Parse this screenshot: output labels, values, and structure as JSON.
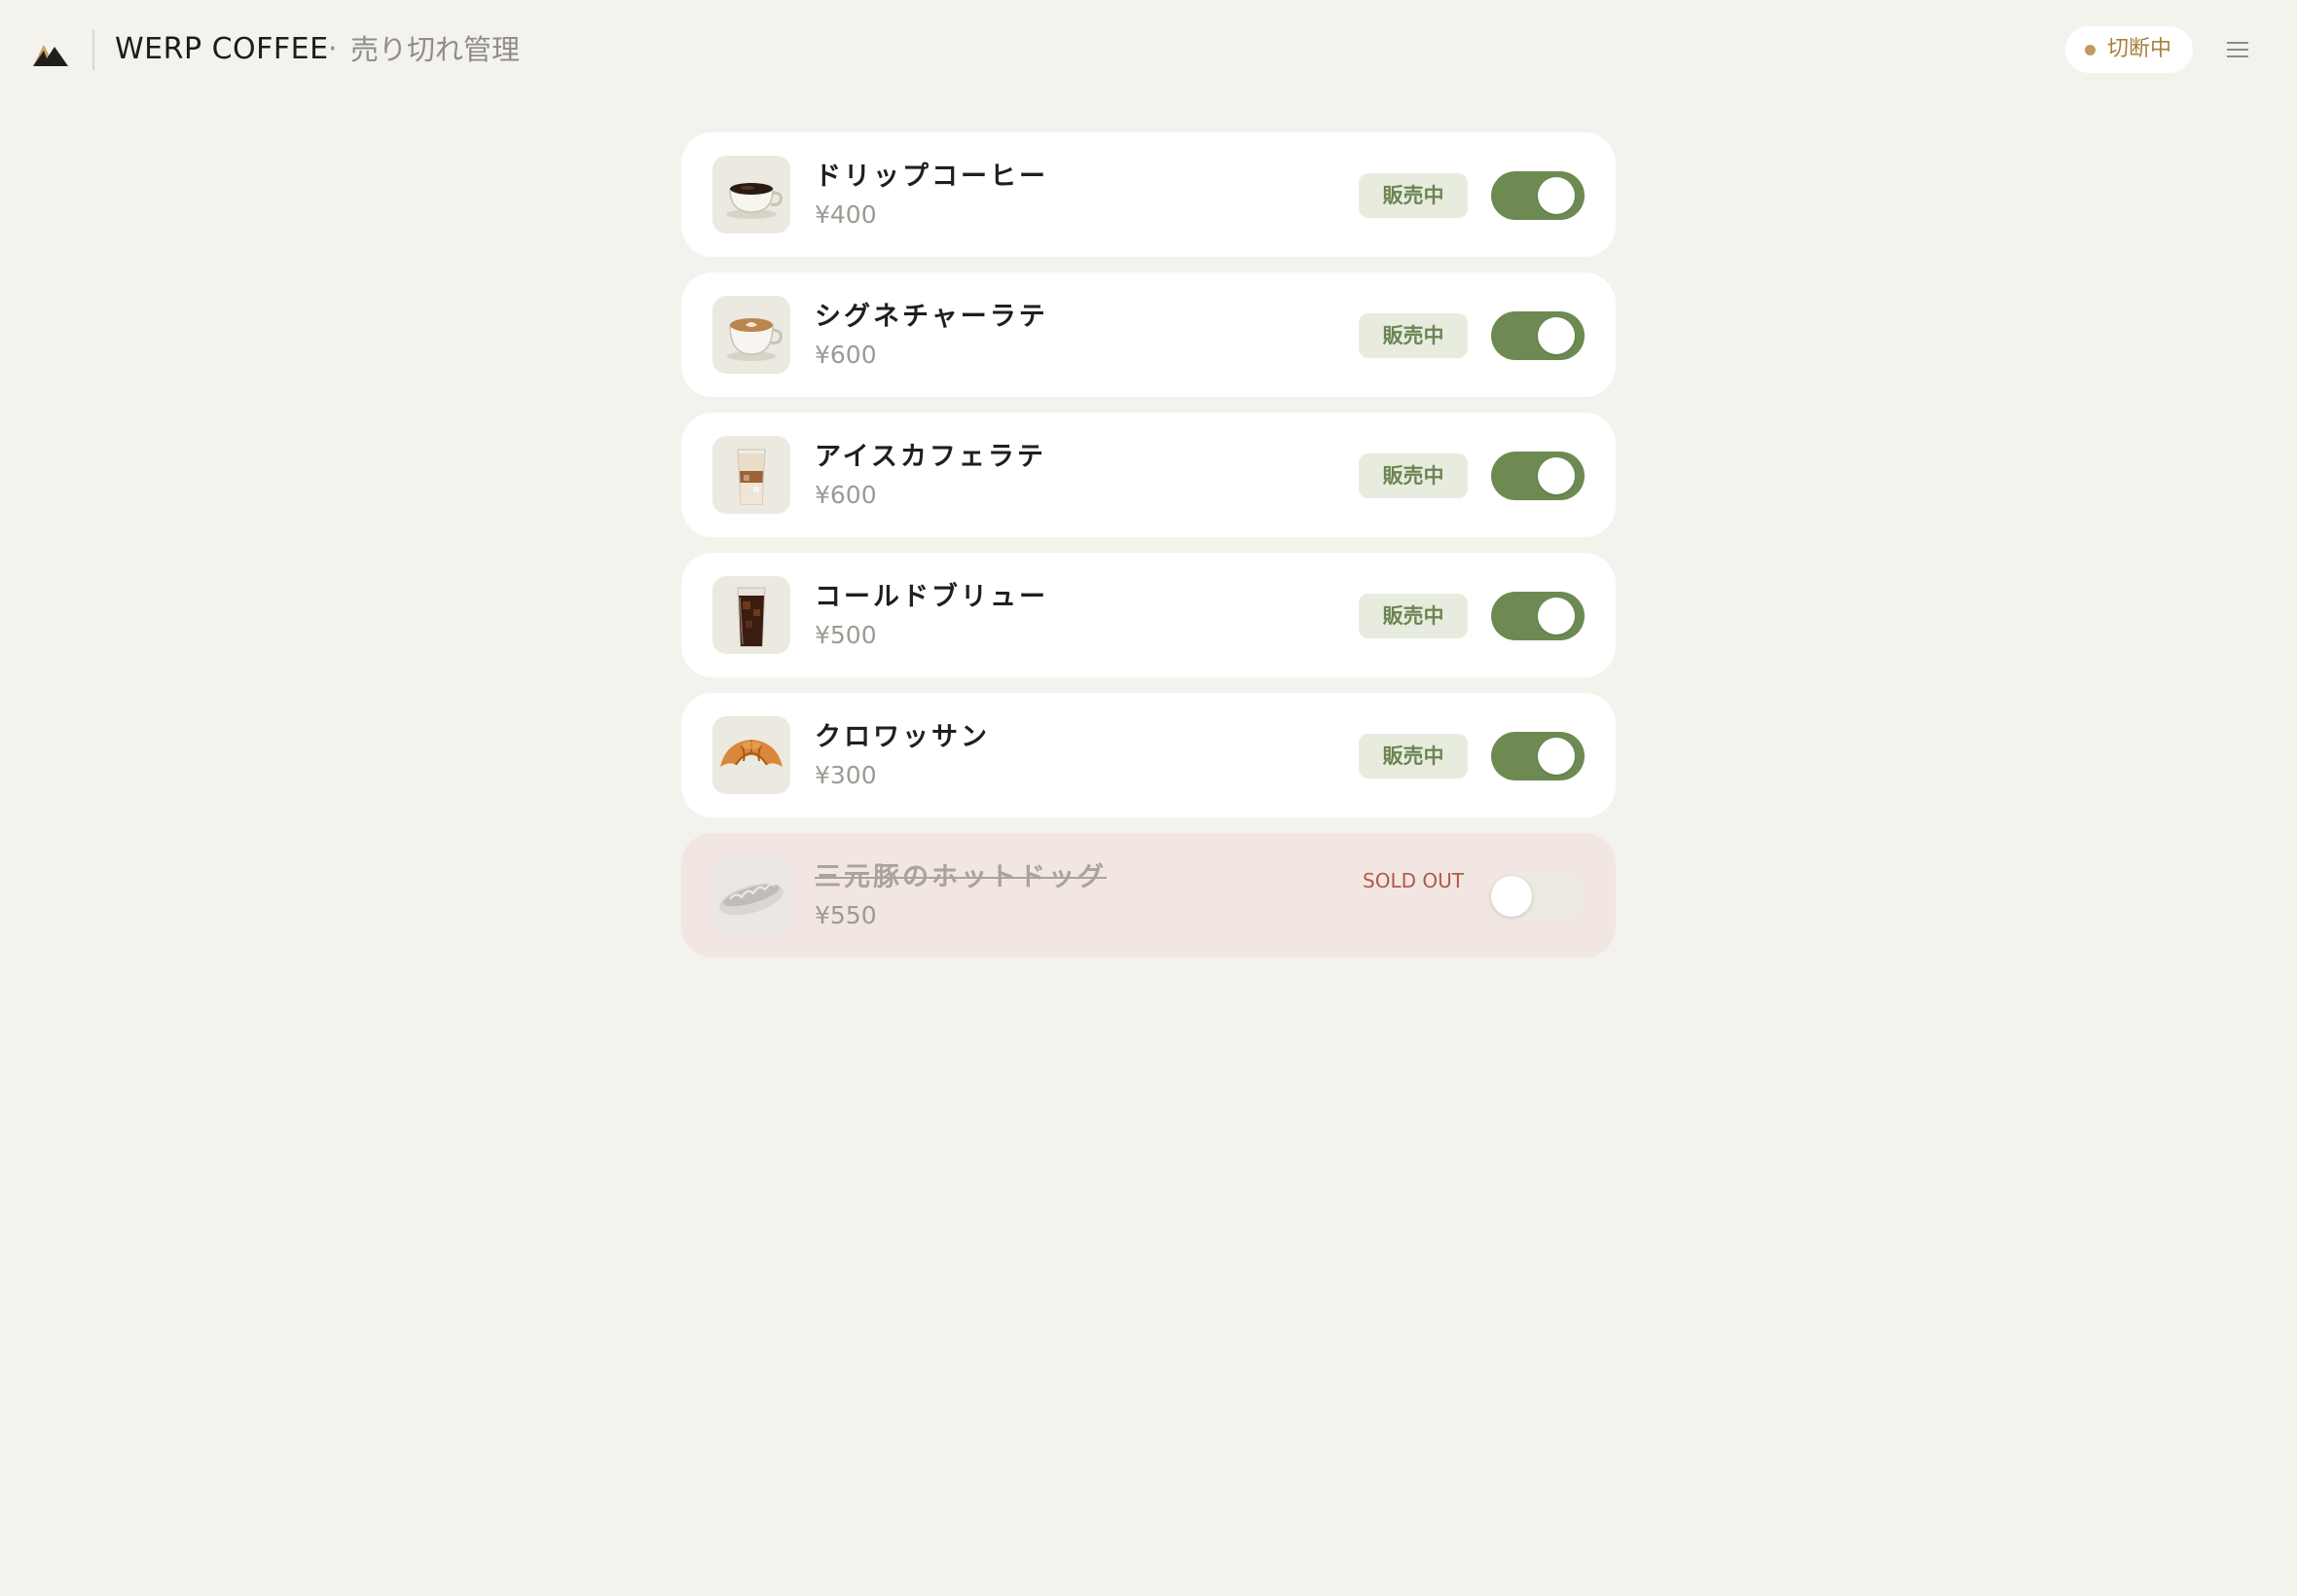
{
  "header": {
    "brand": "WERP COFFEE",
    "separator": "·",
    "subtitle": "売り切れ管理",
    "connection_status": "切断中",
    "status_color": "#c29a5e",
    "menu_icon": "hamburger-menu-icon",
    "logo_icon": "mountain-logo-icon"
  },
  "items": [
    {
      "name": "ドリップコーヒー",
      "price": "¥400",
      "status": "販売中",
      "available": true,
      "image_icon": "drip-coffee-cup-icon"
    },
    {
      "name": "シグネチャーラテ",
      "price": "¥600",
      "status": "販売中",
      "available": true,
      "image_icon": "latte-cup-icon"
    },
    {
      "name": "アイスカフェラテ",
      "price": "¥600",
      "status": "販売中",
      "available": true,
      "image_icon": "iced-latte-glass-icon"
    },
    {
      "name": "コールドブリュー",
      "price": "¥500",
      "status": "販売中",
      "available": true,
      "image_icon": "cold-brew-glass-icon"
    },
    {
      "name": "クロワッサン",
      "price": "¥300",
      "status": "販売中",
      "available": true,
      "image_icon": "croissant-icon"
    },
    {
      "name": "三元豚のホットドッグ",
      "price": "¥550",
      "status": "SOLD OUT",
      "available": false,
      "image_icon": "hot-dog-icon"
    }
  ],
  "colors": {
    "background": "#f3f2ed",
    "accent_green": "#6d8a52",
    "sold_out_red": "#b0594a",
    "sold_out_card": "#f1e6e2"
  }
}
